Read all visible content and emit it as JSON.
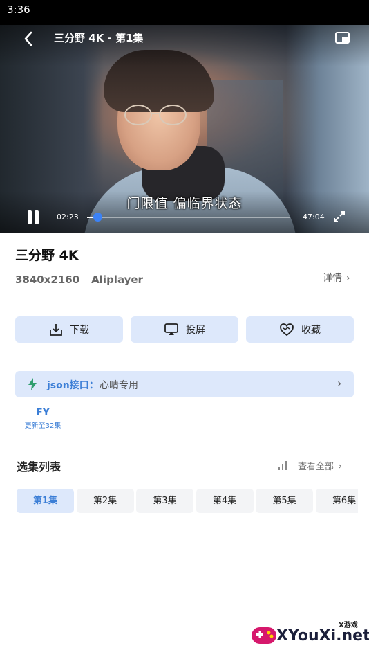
{
  "status_bar": {
    "time": "3:36"
  },
  "player": {
    "title": "三分野 4K - 第1集",
    "subtitle": "门限值 偏临界状态",
    "current_time": "02:23",
    "total_time": "47:04",
    "progress_fraction": 0.051
  },
  "info": {
    "title": "三分野 4K",
    "resolution": "3840x2160",
    "player_engine": "Aliplayer",
    "detail_label": "详情"
  },
  "actions": {
    "download_label": "下载",
    "cast_label": "投屏",
    "favorite_label": "收藏"
  },
  "source": {
    "api_label": "json接口：",
    "api_name": "心晴专用",
    "tab_name": "FY",
    "tab_update": "更新至32集"
  },
  "episodes": {
    "section_title": "选集列表",
    "view_all_label": "查看全部",
    "items": [
      "第1集",
      "第2集",
      "第3集",
      "第4集",
      "第5集",
      "第6集"
    ],
    "active_index": 0
  },
  "watermark": {
    "small_text": "X游戏",
    "site_text": "XYouXi.net"
  },
  "colors": {
    "accent": "#3b7ed6",
    "button_bg": "#dde8fb",
    "progress_knob": "#3b82f6"
  },
  "icons": {
    "back": "back-arrow-icon",
    "pip": "picture-in-picture-icon",
    "pause": "pause-icon",
    "fullscreen": "fullscreen-icon",
    "download": "download-icon",
    "cast": "cast-screen-icon",
    "favorite": "heart-icon",
    "api": "lightning-bolt-icon",
    "sort": "signal-bars-icon"
  }
}
